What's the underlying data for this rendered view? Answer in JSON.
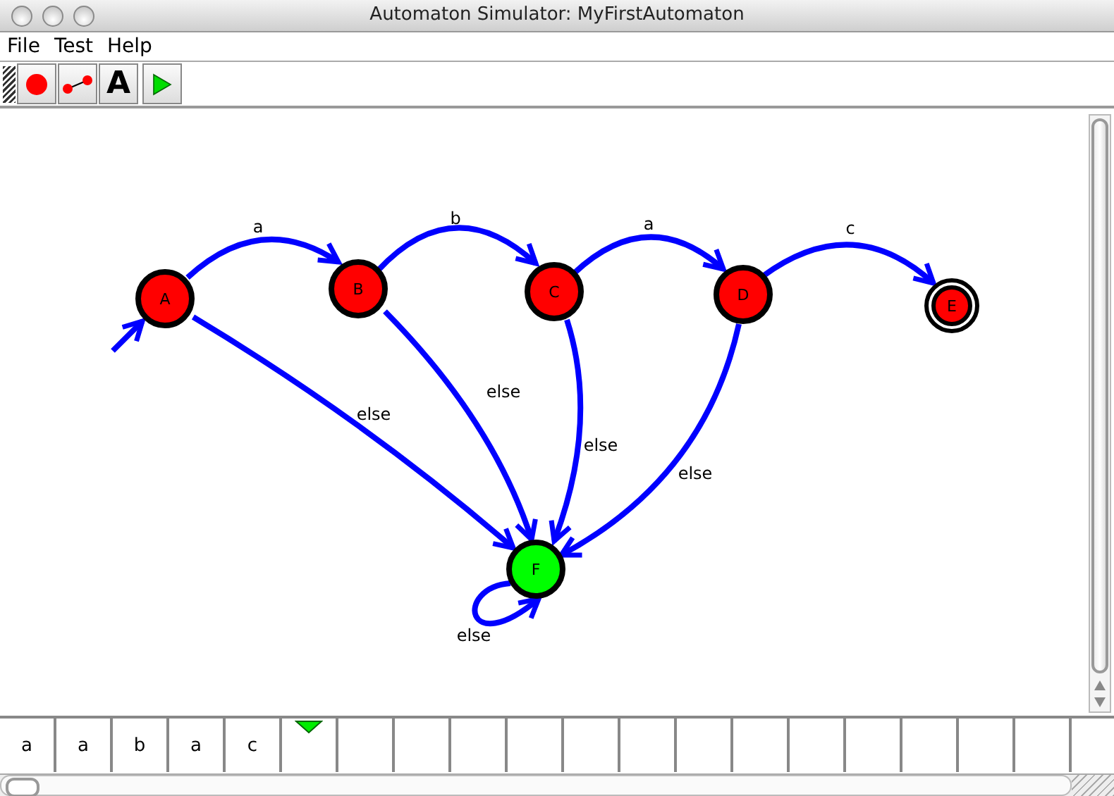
{
  "window": {
    "title": "Automaton Simulator: MyFirstAutomaton"
  },
  "menu": [
    "File",
    "Test",
    "Help"
  ],
  "toolbar": [
    {
      "kind": "state"
    },
    {
      "kind": "transition"
    },
    {
      "kind": "text",
      "glyph": "A"
    },
    {
      "kind": "run"
    }
  ],
  "states": [
    {
      "label": "A",
      "color": "#ff0000",
      "initial": true,
      "accepting": false,
      "transitions": [
        "a",
        "else"
      ]
    },
    {
      "label": "B",
      "color": "#ff0000",
      "initial": false,
      "accepting": false,
      "transitions": [
        "b",
        "else"
      ]
    },
    {
      "label": "C",
      "color": "#ff0000",
      "initial": false,
      "accepting": false,
      "transitions": [
        "a",
        "else"
      ]
    },
    {
      "label": "D",
      "color": "#ff0000",
      "initial": false,
      "accepting": false,
      "transitions": [
        "c",
        "else"
      ]
    },
    {
      "label": "E",
      "color": "#ff0000",
      "initial": false,
      "accepting": true
    },
    {
      "label": "F",
      "color": "#00ff00",
      "initial": false,
      "accepting": false,
      "transitions": [
        "else"
      ]
    }
  ],
  "tape": [
    {
      "symbol": "a",
      "selected": false
    },
    {
      "symbol": "a",
      "selected": false
    },
    {
      "symbol": "b",
      "selected": false
    },
    {
      "symbol": "a",
      "selected": false
    },
    {
      "symbol": "c",
      "selected": false
    },
    {
      "selected": true
    },
    {
      "selected": false
    },
    {
      "selected": false
    },
    {
      "selected": false
    },
    {
      "selected": false
    },
    {
      "selected": false
    },
    {
      "selected": false
    },
    {
      "selected": false
    },
    {
      "selected": false
    },
    {
      "selected": false
    },
    {
      "selected": false
    },
    {
      "selected": false
    },
    {
      "selected": false
    },
    {
      "selected": false
    }
  ]
}
